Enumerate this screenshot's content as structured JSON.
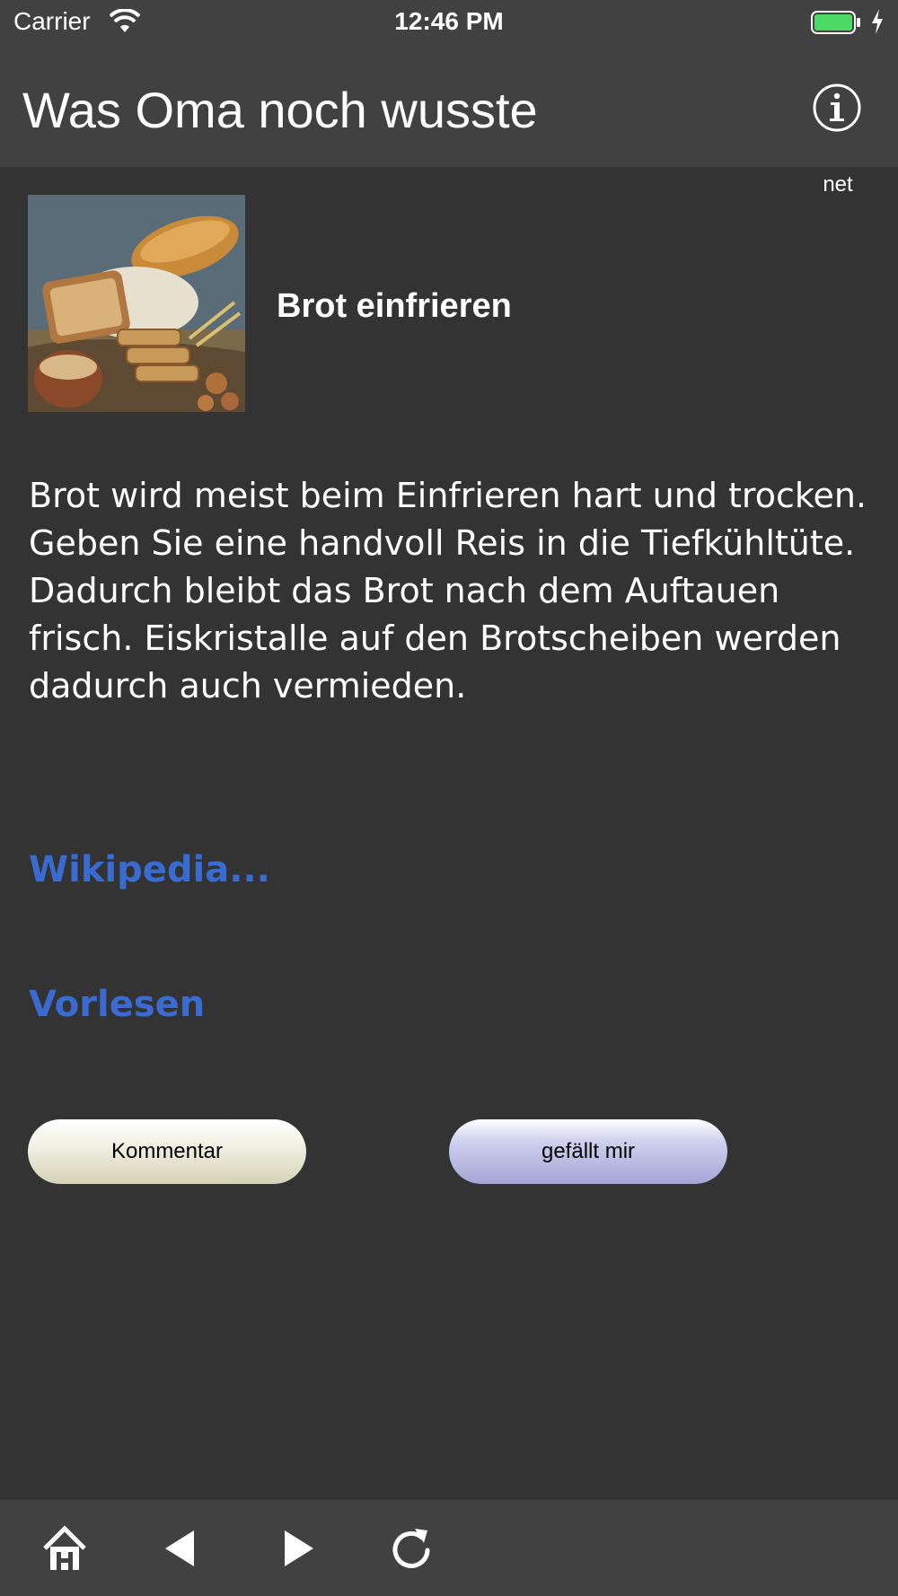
{
  "status": {
    "carrier": "Carrier",
    "time": "12:46 PM",
    "battery_color": "#4cd964"
  },
  "header": {
    "title": "Was Oma noch wusste",
    "info_label": "net"
  },
  "tip": {
    "image_icon": "bread-photo",
    "title": "Brot einfrieren",
    "body": "Brot wird meist beim Einfrieren hart und trocken. Geben Sie eine handvoll Reis in die Tiefkühltüte. Dadurch bleibt das Brot nach dem Auftauen frisch. Eiskristalle auf den Brotscheiben werden dadurch auch vermieden."
  },
  "links": {
    "wikipedia": "Wikipedia...",
    "read_aloud": "Vorlesen",
    "color": "#3a6bd1"
  },
  "buttons": {
    "comment": "Kommentar",
    "like": "gefällt mir"
  },
  "toolbar": {
    "icons": [
      "home-icon",
      "back-icon",
      "forward-icon",
      "reload-icon"
    ]
  }
}
